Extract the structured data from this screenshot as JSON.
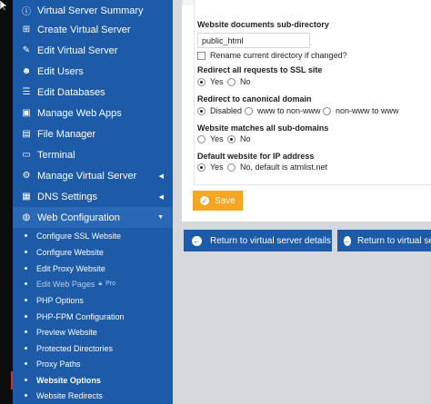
{
  "sidebar": {
    "items": [
      {
        "label": "Virtual Server Summary",
        "icon": "info-icon"
      },
      {
        "label": "Create Virtual Server",
        "icon": "plus-icon"
      },
      {
        "label": "Edit Virtual Server",
        "icon": "edit-icon"
      },
      {
        "label": "Edit Users",
        "icon": "user-icon"
      },
      {
        "label": "Edit Databases",
        "icon": "database-icon"
      },
      {
        "label": "Manage Web Apps",
        "icon": "apps-icon"
      },
      {
        "label": "File Manager",
        "icon": "file-icon"
      },
      {
        "label": "Terminal",
        "icon": "terminal-icon"
      },
      {
        "label": "Manage Virtual Server",
        "icon": "cogs-icon"
      },
      {
        "label": "DNS Settings",
        "icon": "dns-icon"
      },
      {
        "label": "Web Configuration",
        "icon": "globe-icon"
      }
    ],
    "subitems": [
      {
        "label": "Configure SSL Website"
      },
      {
        "label": "Configure Website"
      },
      {
        "label": "Edit Proxy Website"
      },
      {
        "label": "Edit Web Pages",
        "badge": "Pro"
      },
      {
        "label": "PHP Options"
      },
      {
        "label": "PHP-FPM Configuration"
      },
      {
        "label": "Preview Website"
      },
      {
        "label": "Protected Directories"
      },
      {
        "label": "Proxy Paths"
      },
      {
        "label": "Website Options"
      },
      {
        "label": "Website Redirects"
      }
    ]
  },
  "form": {
    "subdir_label": "Website documents sub-directory",
    "subdir_value": "public_html",
    "rename_label": "Rename current directory if changed?",
    "ssl_label": "Redirect all requests to SSL site",
    "ssl_yes": "Yes",
    "ssl_no": "No",
    "canon_label": "Redirect to canonical domain",
    "canon_disabled": "Disabled",
    "canon_www_to_non": "www to non-www",
    "canon_non_to_www": "non-www to www",
    "sub_label": "Website matches all sub-domains",
    "sub_yes": "Yes",
    "sub_no": "No",
    "ip_label": "Default website for IP address",
    "ip_yes": "Yes",
    "ip_no": "No, default is atmlist.net"
  },
  "actions": {
    "save": "Save",
    "return1": "Return to virtual server details",
    "return2": "Return to virtual se"
  },
  "colors": {
    "sidebar_bg": "#1d5aa8",
    "save_bg": "#f5a623",
    "return_bg": "#1d5aa8"
  }
}
